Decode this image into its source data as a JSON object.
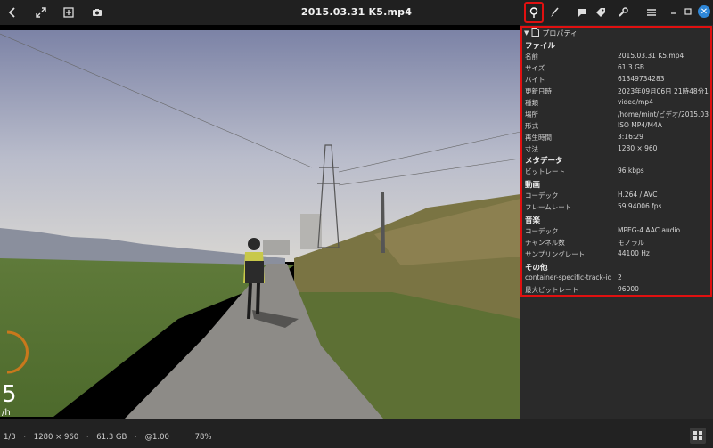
{
  "window": {
    "title": "2015.03.31 K5.mp4"
  },
  "panel": {
    "header": "プロパティ",
    "sections": [
      {
        "title": "ファイル",
        "rows": [
          {
            "key": "名前",
            "value": "2015.03.31 K5.mp4"
          },
          {
            "key": "サイズ",
            "value": "61.3 GB"
          },
          {
            "key": "バイト",
            "value": "61349734283"
          },
          {
            "key": "更新日時",
            "value": "2023年09月06日 21時48分12秒"
          },
          {
            "key": "種類",
            "value": "video/mp4"
          },
          {
            "key": "場所",
            "value": "/home/mint/ビデオ/2015.03.31"
          },
          {
            "key": "形式",
            "value": "ISO MP4/M4A"
          },
          {
            "key": "再生時間",
            "value": "3:16:29"
          },
          {
            "key": "寸法",
            "value": "1280 × 960"
          }
        ]
      },
      {
        "title": "メタデータ",
        "rows": [
          {
            "key": "ビットレート",
            "value": "96 kbps"
          }
        ]
      },
      {
        "title": "動画",
        "rows": [
          {
            "key": "コーデック",
            "value": "H.264 / AVC"
          },
          {
            "key": "フレームレート",
            "value": "59.94006 fps"
          }
        ]
      },
      {
        "title": "音楽",
        "rows": [
          {
            "key": "コーデック",
            "value": "MPEG-4 AAC audio"
          },
          {
            "key": "チャンネル数",
            "value": "モノラル"
          },
          {
            "key": "サンプリングレート",
            "value": "44100 Hz"
          }
        ]
      },
      {
        "title": "その他",
        "rows": [
          {
            "key": "container-specific-track-id",
            "value": "2"
          },
          {
            "key": "最大ビットレート",
            "value": "96000"
          }
        ]
      }
    ]
  },
  "overlay": {
    "speed": "5",
    "speed_unit": "/h"
  },
  "status": {
    "index": "1/3",
    "sep": "·",
    "dimensions": "1280 × 960",
    "size": "61.3 GB",
    "zoom_factor": "@1.00",
    "zoom_percent": "78%"
  },
  "icons": {
    "back": "chevron-left-icon",
    "fullscreen": "expand-icon",
    "add": "add-image-icon",
    "snapshot": "camera-icon",
    "properties": "info-icon",
    "edit": "brush-icon",
    "comment": "comment-icon",
    "tag": "tag-icon",
    "tools": "wrench-icon",
    "menu": "hamburger-menu-icon",
    "minimize": "minimize-icon",
    "maximize": "maximize-icon",
    "close": "close-icon",
    "grid": "grid-icon"
  },
  "colors": {
    "highlight": "#e01010",
    "close_button": "#2e87d8"
  }
}
